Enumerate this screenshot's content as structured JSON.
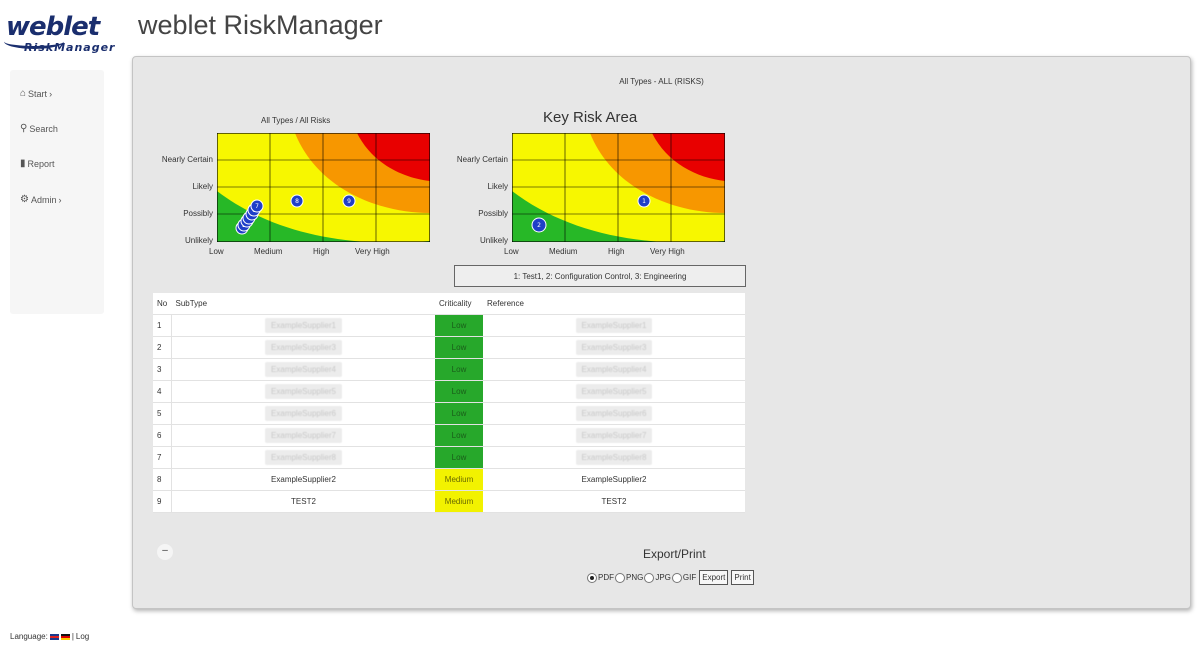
{
  "app": {
    "title": "weblet RiskManager",
    "logo_word": "weblet",
    "logo_sub": "RiskManager"
  },
  "sidebar": {
    "items": [
      {
        "label": "Start",
        "icon": "home-icon",
        "caret": "›"
      },
      {
        "label": "Search",
        "icon": "search-icon",
        "caret": ""
      },
      {
        "label": "Report",
        "icon": "bar-chart-icon",
        "caret": ""
      },
      {
        "label": "Admin",
        "icon": "gear-icon",
        "caret": "›"
      }
    ]
  },
  "main": {
    "heading": "All Types - ALL (RISKS)"
  },
  "matrix_left": {
    "title": "All Types / All Risks",
    "y_labels": [
      "Nearly Certain",
      "Likely",
      "Possibly",
      "Unlikely"
    ],
    "x_labels": [
      "Low",
      "Medium",
      "High",
      "Very High"
    ],
    "markers": [
      "1",
      "2",
      "3",
      "4",
      "5",
      "6",
      "7",
      "8",
      "9"
    ]
  },
  "matrix_right": {
    "title": "Key Risk Area",
    "y_labels": [
      "Nearly Certain",
      "Likely",
      "Possibly",
      "Unlikely"
    ],
    "x_labels": [
      "Low",
      "Medium",
      "High",
      "Very High"
    ],
    "markers": [
      "2",
      "1"
    ]
  },
  "legend_text": "1: Test1, 2: Configuration Control, 3: Engineering",
  "table": {
    "headers": {
      "no": "No",
      "subtype": "SubType",
      "criticality": "Criticality",
      "reference": "Reference"
    },
    "rows": [
      {
        "no": "1",
        "subtype": "ExampleSupplier1",
        "criticality": "Low",
        "reference": "ExampleSupplier1",
        "blur": true
      },
      {
        "no": "2",
        "subtype": "ExampleSupplier3",
        "criticality": "Low",
        "reference": "ExampleSupplier3",
        "blur": true
      },
      {
        "no": "3",
        "subtype": "ExampleSupplier4",
        "criticality": "Low",
        "reference": "ExampleSupplier4",
        "blur": true
      },
      {
        "no": "4",
        "subtype": "ExampleSupplier5",
        "criticality": "Low",
        "reference": "ExampleSupplier5",
        "blur": true
      },
      {
        "no": "5",
        "subtype": "ExampleSupplier6",
        "criticality": "Low",
        "reference": "ExampleSupplier6",
        "blur": true
      },
      {
        "no": "6",
        "subtype": "ExampleSupplier7",
        "criticality": "Low",
        "reference": "ExampleSupplier7",
        "blur": true
      },
      {
        "no": "7",
        "subtype": "ExampleSupplier8",
        "criticality": "Low",
        "reference": "ExampleSupplier8",
        "blur": true
      },
      {
        "no": "8",
        "subtype": "ExampleSupplier2",
        "criticality": "Medium",
        "reference": "ExampleSupplier2",
        "blur": false
      },
      {
        "no": "9",
        "subtype": "TEST2",
        "criticality": "Medium",
        "reference": "TEST2",
        "blur": false
      }
    ]
  },
  "collapse_label": "–",
  "export": {
    "title": "Export/Print",
    "formats": [
      {
        "label": "PDF",
        "selected": true
      },
      {
        "label": "PNG",
        "selected": false
      },
      {
        "label": "JPG",
        "selected": false
      },
      {
        "label": "GIF",
        "selected": false
      }
    ],
    "export_label": "Export",
    "print_label": "Print"
  },
  "footer": {
    "language_label": "Language:",
    "separator": "|",
    "log_label": "Log"
  },
  "colors": {
    "green": "#27b827",
    "yellow": "#f7f700",
    "orange": "#f79700",
    "red": "#e80000",
    "marker": "#1f3fc8",
    "low": "#27a82b",
    "medium": "#f2f200"
  }
}
